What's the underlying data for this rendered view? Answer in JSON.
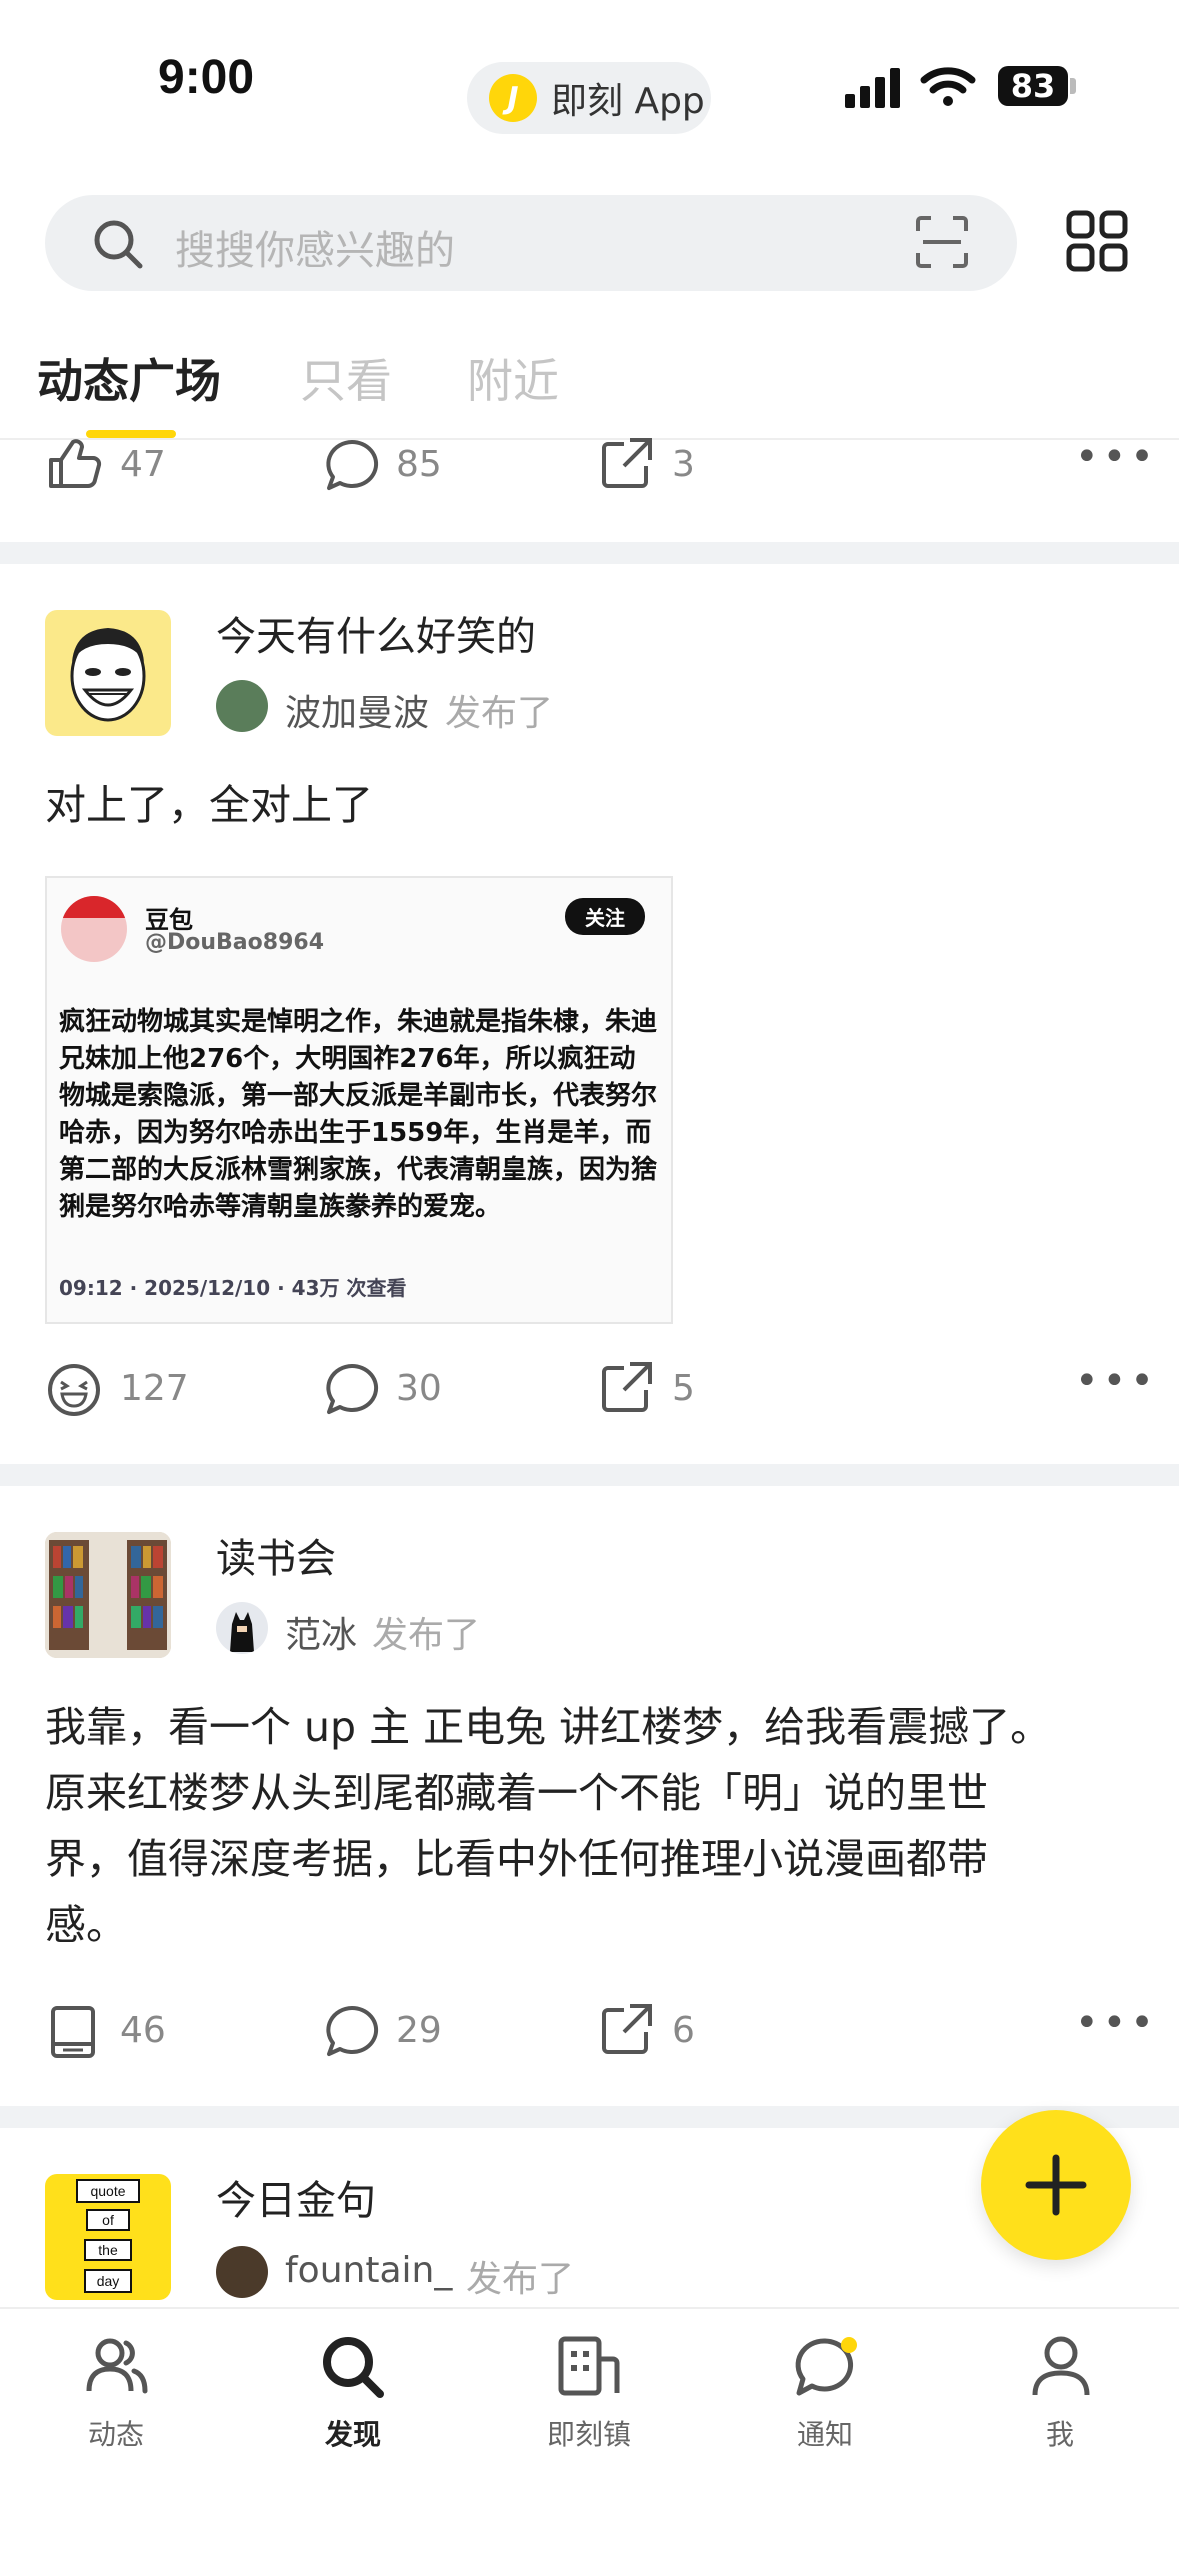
{
  "status_bar": {
    "time": "9:00",
    "island_app": "即刻 App",
    "battery": "83"
  },
  "search": {
    "placeholder": "搜搜你感兴趣的"
  },
  "tabs": [
    {
      "label": "动态广场",
      "active": true
    },
    {
      "label": "只看",
      "active": false
    },
    {
      "label": "附近",
      "active": false
    }
  ],
  "prev_post": {
    "like_count": "47",
    "comment_count": "85",
    "share_count": "3"
  },
  "posts": [
    {
      "topic": "今天有什么好笑的",
      "author": "波加曼波",
      "published_label": "发布了",
      "text": "对上了，全对上了",
      "image_card": {
        "name": "豆包",
        "handle": "@DouBao8964",
        "follow_label": "关注",
        "body": "疯狂动物城其实是悼明之作，朱迪就是指朱棣，朱迪兄妹加上他276个，大明国祚276年，所以疯狂动物城是索隐派，第一部大反派是羊副市长，代表努尔哈赤，因为努尔哈赤出生于1559年，生肖是羊，而第二部的大反派林雪猁家族，代表清朝皇族，因为猞猁是努尔哈赤等清朝皇族豢养的爱宠。",
        "meta": "09:12 · 2025/12/10 · 43万 次查看"
      },
      "reaction_icon": "laugh-emoji-icon",
      "reaction_count": "127",
      "comment_count": "30",
      "share_count": "5"
    },
    {
      "topic": "读书会",
      "author": "范冰",
      "published_label": "发布了",
      "text_lines": [
        "我靠，看一个 up 主 正电兔 讲红楼梦，给我看震撼了。",
        "原来红楼梦从头到尾都藏着一个不能「明」说的里世",
        "界，值得深度考据，比看中外任何推理小说漫画都带",
        "感。"
      ],
      "reaction_icon": "book-icon",
      "reaction_count": "46",
      "comment_count": "29",
      "share_count": "6"
    },
    {
      "topic": "今日金句",
      "author": "fountain_",
      "published_label": "发布了",
      "avatar_words": [
        "quote",
        "of",
        "the",
        "day"
      ]
    }
  ],
  "bottom_nav": [
    {
      "label": "动态",
      "icon": "people-icon",
      "active": false
    },
    {
      "label": "发现",
      "icon": "search-icon",
      "active": true
    },
    {
      "label": "即刻镇",
      "icon": "building-icon",
      "active": false
    },
    {
      "label": "通知",
      "icon": "chat-bubble-icon",
      "active": false,
      "badge": true
    },
    {
      "label": "我",
      "icon": "person-icon",
      "active": false
    }
  ],
  "colors": {
    "accent": "#ffd60a",
    "fab": "#ffe01b",
    "muted": "#888888"
  }
}
